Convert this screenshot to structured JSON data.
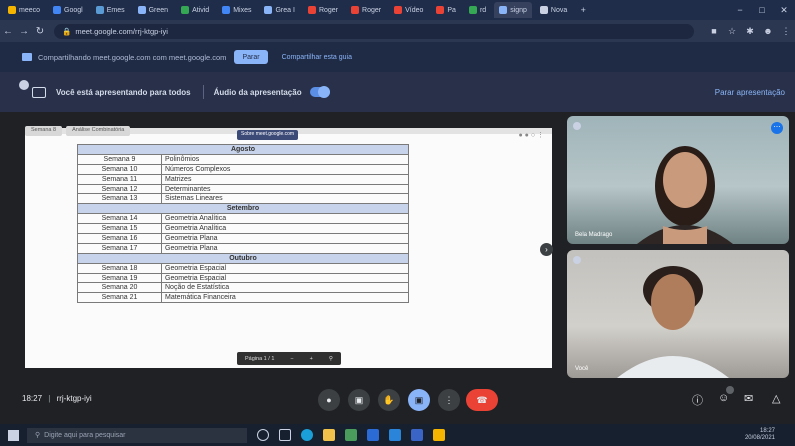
{
  "browser": {
    "tabs": [
      {
        "label": "meeco"
      },
      {
        "label": "Googl"
      },
      {
        "label": "Emes"
      },
      {
        "label": "Green"
      },
      {
        "label": "Ativid"
      },
      {
        "label": "Mixes"
      },
      {
        "label": "Grea I"
      },
      {
        "label": "Roger"
      },
      {
        "label": "Roger"
      },
      {
        "label": "Vídeo"
      },
      {
        "label": "Pa"
      },
      {
        "label": "rd"
      },
      {
        "label": "signp"
      },
      {
        "label": "Nova"
      }
    ],
    "new_tab_label": "+",
    "url": "meet.google.com/rrj-ktgp-iyi"
  },
  "share_bar": {
    "text": "Compartilhando meet.google.com com meet.google.com",
    "stop_label": "Parar",
    "toggle_label": "Compartilhar esta guia"
  },
  "presenting_bar": {
    "status": "Você está apresentando para todos",
    "audio_label": "Áudio da apresentação",
    "stop_label": "Parar apresentação"
  },
  "document": {
    "tabs": [
      "Semana 8",
      "Análise Combinatória"
    ],
    "share_chip": "Sobre meet.google.com",
    "table": [
      {
        "type": "header",
        "text": "Agosto"
      },
      {
        "type": "row",
        "week": "Semana 9",
        "topic": "Polinômios"
      },
      {
        "type": "row",
        "week": "Semana 10",
        "topic": "Números Complexos"
      },
      {
        "type": "row",
        "week": "Semana 11",
        "topic": "Matrizes"
      },
      {
        "type": "row",
        "week": "Semana 12",
        "topic": "Determinantes"
      },
      {
        "type": "row",
        "week": "Semana 13",
        "topic": "Sistemas Lineares"
      },
      {
        "type": "header",
        "text": "Setembro"
      },
      {
        "type": "row",
        "week": "Semana 14",
        "topic": "Geometria Analítica"
      },
      {
        "type": "row",
        "week": "Semana 15",
        "topic": "Geometria Analítica"
      },
      {
        "type": "row",
        "week": "Semana 16",
        "topic": "Geometria Plana"
      },
      {
        "type": "row",
        "week": "Semana 17",
        "topic": "Geometria Plana"
      },
      {
        "type": "header",
        "text": "Outubro"
      },
      {
        "type": "row",
        "week": "Semana 18",
        "topic": "Geometria Espacial"
      },
      {
        "type": "row",
        "week": "Semana 19",
        "topic": "Geometria Espacial"
      },
      {
        "type": "row",
        "week": "Semana 20",
        "topic": "Noção de Estatística"
      },
      {
        "type": "row",
        "week": "Semana 21",
        "topic": "Matemática Financeira"
      }
    ],
    "page_bar": "Página 1 / 1"
  },
  "participants": [
    {
      "name": "Bela Madrago"
    },
    {
      "name": "Você"
    }
  ],
  "meeting": {
    "time": "18:27",
    "separator": "|",
    "code": "rrj-ktgp-iyi"
  },
  "taskbar": {
    "search_placeholder": "Digite aqui para pesquisar",
    "time": "18:27",
    "date": "20/08/2021"
  },
  "colors": {
    "end_call": "#ea4335",
    "accent_blue": "#8ab4f8",
    "table_header": "#c6d3ea"
  }
}
